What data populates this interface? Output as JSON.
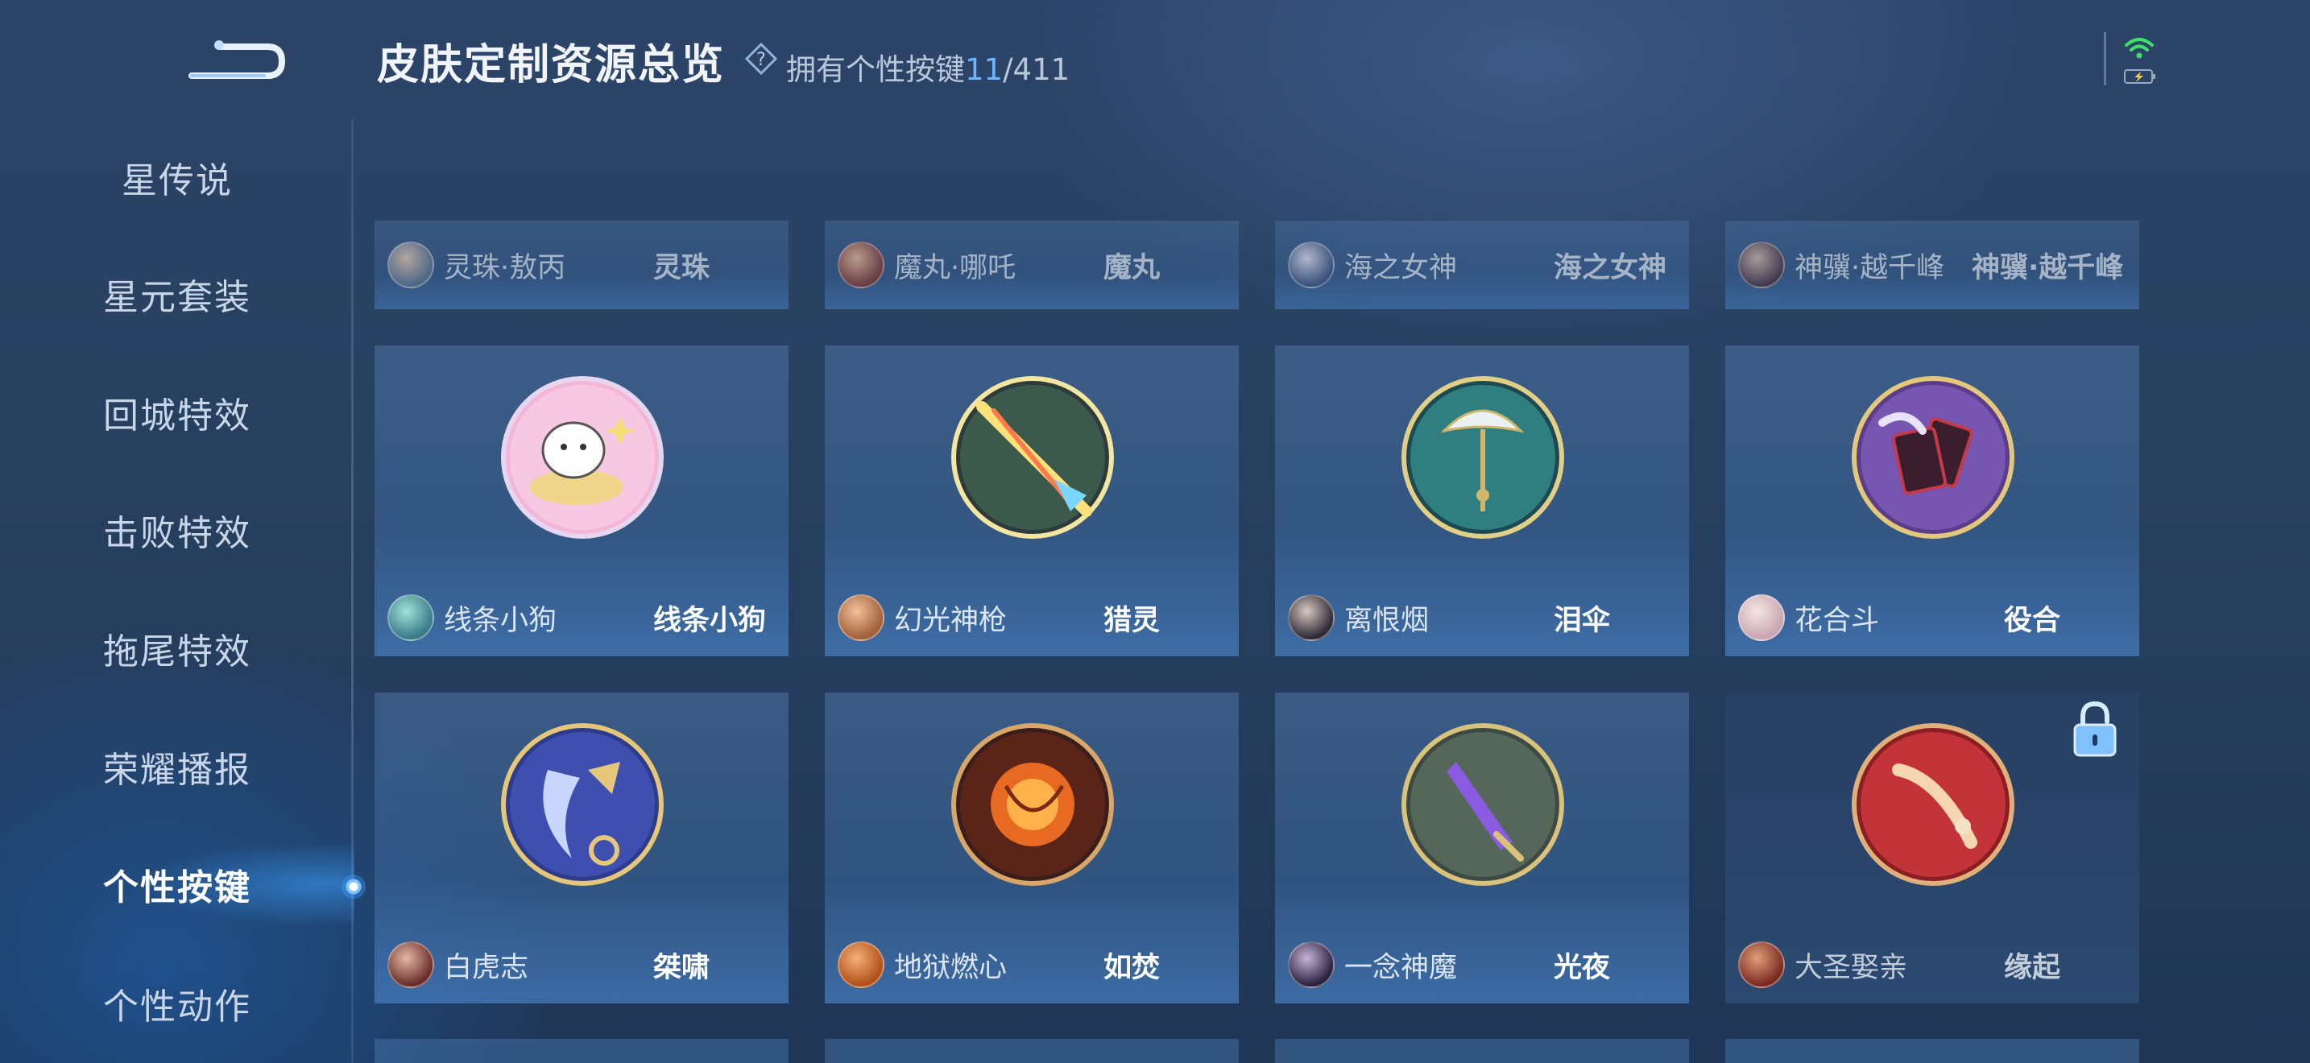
{
  "header": {
    "title": "皮肤定制资源总览",
    "subtitle_prefix": "拥有个性按键",
    "owned": "11",
    "total_sep": "/411"
  },
  "sidebar": {
    "items": [
      {
        "label": "星传说"
      },
      {
        "label": "星元套装"
      },
      {
        "label": "回城特效"
      },
      {
        "label": "击败特效"
      },
      {
        "label": "拖尾特效"
      },
      {
        "label": "荣耀播报"
      },
      {
        "label": "个性按键",
        "active": true
      },
      {
        "label": "个性动作"
      }
    ]
  },
  "grid": {
    "row0": [
      {
        "hero": "灵珠·敖丙",
        "skin": "灵珠"
      },
      {
        "hero": "魔丸·哪吒",
        "skin": "魔丸"
      },
      {
        "hero": "海之女神",
        "skin": "海之女神"
      },
      {
        "hero": "神骥·越千峰",
        "skin": "神骥·越千峰"
      }
    ],
    "row1": [
      {
        "hero": "线条小狗",
        "skin": "线条小狗"
      },
      {
        "hero": "幻光神枪",
        "skin": "猎灵"
      },
      {
        "hero": "离恨烟",
        "skin": "泪伞"
      },
      {
        "hero": "花合斗",
        "skin": "役合"
      }
    ],
    "row2": [
      {
        "hero": "白虎志",
        "skin": "桀啸"
      },
      {
        "hero": "地狱燃心",
        "skin": "如焚"
      },
      {
        "hero": "一念神魔",
        "skin": "光夜"
      },
      {
        "hero": "大圣娶亲",
        "skin": "缘起",
        "locked": true
      }
    ]
  },
  "colors": {
    "accent": "#6fb4ff",
    "background": "#28405f",
    "wifi": "#3ee06a",
    "battery": "#f5d13a"
  }
}
